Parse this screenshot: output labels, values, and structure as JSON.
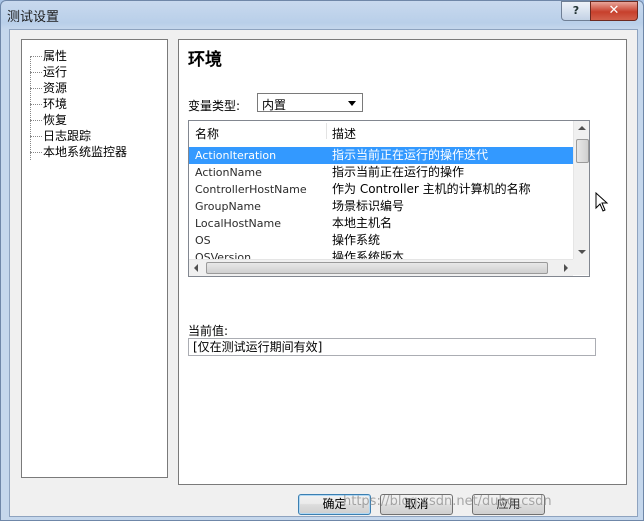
{
  "window": {
    "title": "测试设置",
    "help_label": "?",
    "close_label": "✕"
  },
  "tree": {
    "items": [
      "属性",
      "运行",
      "资源",
      "环境",
      "恢复",
      "日志跟踪",
      "本地系统监控器"
    ]
  },
  "section": {
    "title": "环境",
    "var_type_label": "变量类型:",
    "var_type_value": "内置"
  },
  "table": {
    "headers": [
      "名称",
      "描述"
    ],
    "rows": [
      {
        "name": "ActionIteration",
        "desc": "指示当前正在运行的操作迭代",
        "selected": true
      },
      {
        "name": "ActionName",
        "desc": "指示当前正在运行的操作"
      },
      {
        "name": "ControllerHostName",
        "desc": "作为 Controller 主机的计算机的名称"
      },
      {
        "name": "GroupName",
        "desc": "场景标识编号"
      },
      {
        "name": "LocalHostName",
        "desc": "本地主机名"
      },
      {
        "name": "OS",
        "desc": "操作系统"
      },
      {
        "name": "OSVersion",
        "desc": "操作系统版本"
      }
    ]
  },
  "current_value": {
    "label": "当前值:",
    "value": "[仅在测试运行期间有效]"
  },
  "buttons": {
    "ok": "确定",
    "cancel": "取消",
    "apply": "应用"
  },
  "watermark": "https://blog.csdn.net/dubo_csdn",
  "colors": {
    "selection": "#3399ff",
    "close_button": "#c7402c"
  }
}
